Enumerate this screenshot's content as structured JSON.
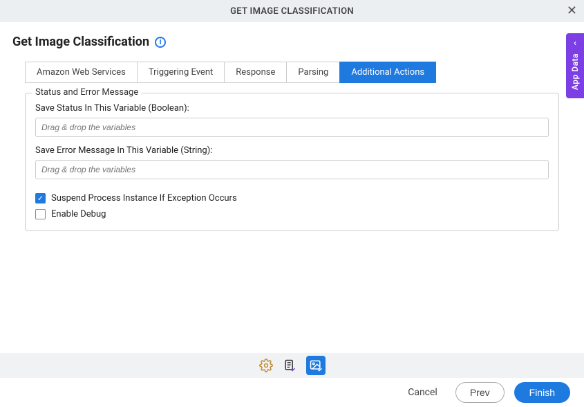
{
  "titlebar": {
    "title": "GET IMAGE CLASSIFICATION"
  },
  "header": {
    "title": "Get Image Classification"
  },
  "tabs": [
    {
      "label": "Amazon Web Services",
      "active": false
    },
    {
      "label": "Triggering Event",
      "active": false
    },
    {
      "label": "Response",
      "active": false
    },
    {
      "label": "Parsing",
      "active": false
    },
    {
      "label": "Additional Actions",
      "active": true
    }
  ],
  "fieldset": {
    "legend": "Status and Error Message",
    "status_label": "Save Status In This Variable (Boolean):",
    "status_placeholder": "Drag & drop the variables",
    "error_label": "Save Error Message In This Variable (String):",
    "error_placeholder": "Drag & drop the variables",
    "suspend_label": "Suspend Process Instance If Exception Occurs",
    "suspend_checked": true,
    "debug_label": "Enable Debug",
    "debug_checked": false
  },
  "buttons": {
    "cancel": "Cancel",
    "prev": "Prev",
    "finish": "Finish"
  },
  "side_panel": {
    "label": "App Data"
  },
  "toolbar_icons": {
    "settings": "settings-icon",
    "document": "document-check-icon",
    "image": "image-check-icon"
  }
}
